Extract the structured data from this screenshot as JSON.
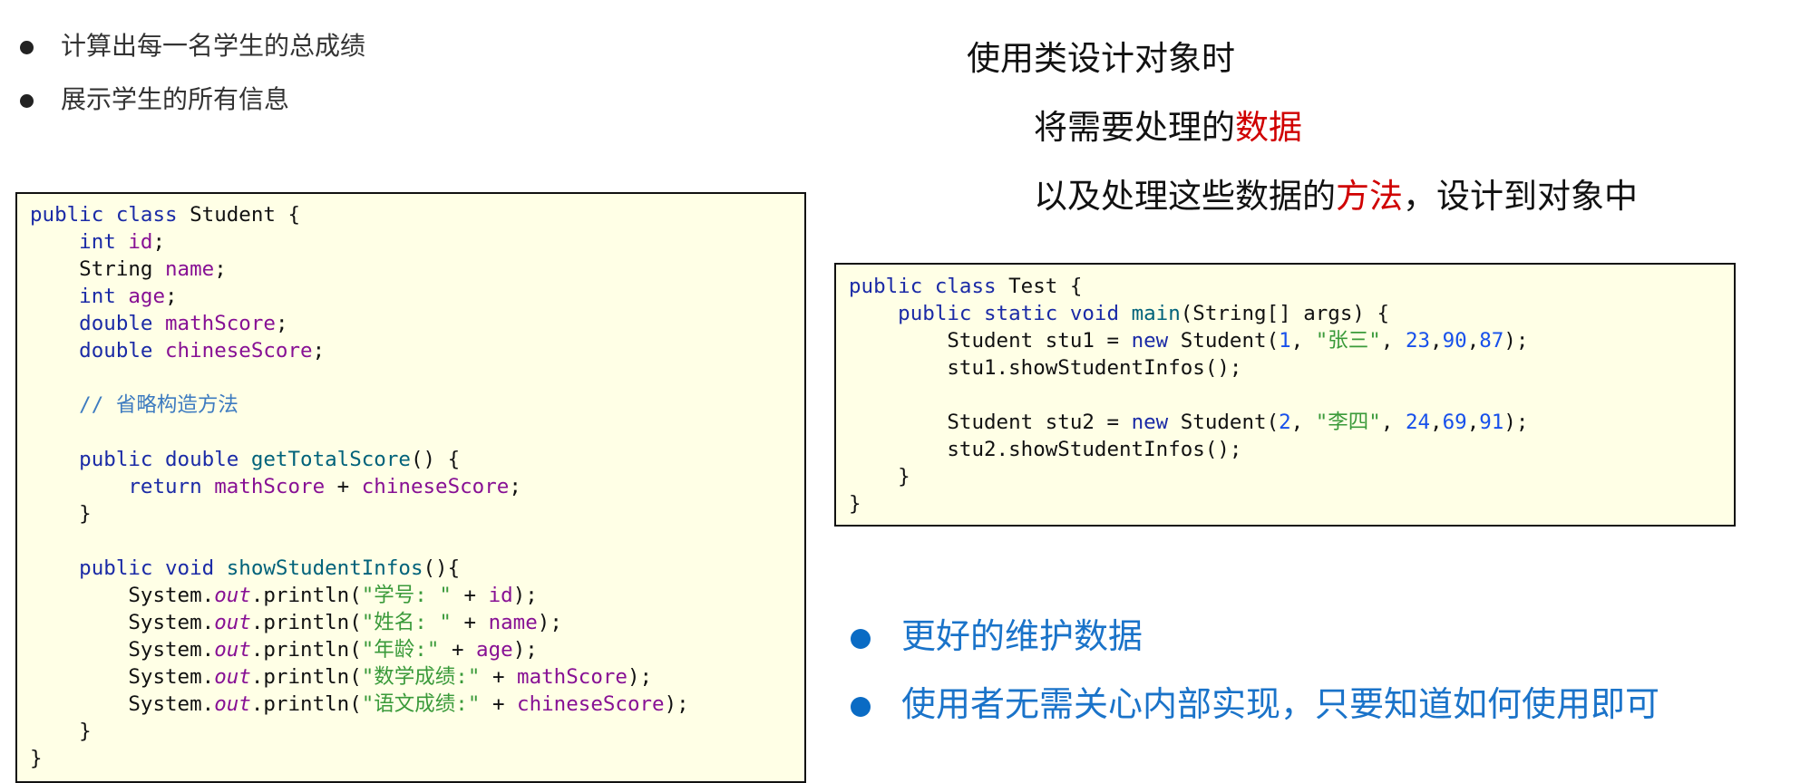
{
  "top_bullets": [
    "计算出每一名学生的总成绩",
    "展示学生的所有信息"
  ],
  "heading": {
    "line1": "使用类设计对象时",
    "line2_prefix": "将需要处理的",
    "line2_highlight": "数据",
    "line3_prefix": "以及处理这些数据的",
    "line3_highlight": "方法",
    "line3_suffix": "，设计到对象中",
    "highlight_color": "#d00000"
  },
  "student_code": [
    [
      {
        "t": "public class ",
        "c": "kw"
      },
      {
        "t": "Student {",
        "c": ""
      }
    ],
    [
      {
        "t": "    int ",
        "c": "kw"
      },
      {
        "t": "id",
        "c": "fld"
      },
      {
        "t": ";",
        "c": ""
      }
    ],
    [
      {
        "t": "    String ",
        "c": ""
      },
      {
        "t": "name",
        "c": "fld"
      },
      {
        "t": ";",
        "c": ""
      }
    ],
    [
      {
        "t": "    int ",
        "c": "kw"
      },
      {
        "t": "age",
        "c": "fld"
      },
      {
        "t": ";",
        "c": ""
      }
    ],
    [
      {
        "t": "    double ",
        "c": "kw"
      },
      {
        "t": "mathScore",
        "c": "fld"
      },
      {
        "t": ";",
        "c": ""
      }
    ],
    [
      {
        "t": "    double ",
        "c": "kw"
      },
      {
        "t": "chineseScore",
        "c": "fld"
      },
      {
        "t": ";",
        "c": ""
      }
    ],
    [],
    [
      {
        "t": "    // 省略构造方法",
        "c": "cmt"
      }
    ],
    [],
    [
      {
        "t": "    public double ",
        "c": "kw"
      },
      {
        "t": "getTotalScore",
        "c": "mth"
      },
      {
        "t": "() {",
        "c": ""
      }
    ],
    [
      {
        "t": "        return ",
        "c": "kw"
      },
      {
        "t": "mathScore",
        "c": "fld"
      },
      {
        "t": " + ",
        "c": ""
      },
      {
        "t": "chineseScore",
        "c": "fld"
      },
      {
        "t": ";",
        "c": ""
      }
    ],
    [
      {
        "t": "    }",
        "c": ""
      }
    ],
    [],
    [
      {
        "t": "    public void ",
        "c": "kw"
      },
      {
        "t": "showStudentInfos",
        "c": "mth"
      },
      {
        "t": "(){",
        "c": ""
      }
    ],
    [
      {
        "t": "        System.",
        "c": ""
      },
      {
        "t": "out",
        "c": "it"
      },
      {
        "t": ".println(",
        "c": ""
      },
      {
        "t": "\"学号: \"",
        "c": "str"
      },
      {
        "t": " + ",
        "c": ""
      },
      {
        "t": "id",
        "c": "fld"
      },
      {
        "t": ");",
        "c": ""
      }
    ],
    [
      {
        "t": "        System.",
        "c": ""
      },
      {
        "t": "out",
        "c": "it"
      },
      {
        "t": ".println(",
        "c": ""
      },
      {
        "t": "\"姓名: \"",
        "c": "str"
      },
      {
        "t": " + ",
        "c": ""
      },
      {
        "t": "name",
        "c": "fld"
      },
      {
        "t": ");",
        "c": ""
      }
    ],
    [
      {
        "t": "        System.",
        "c": ""
      },
      {
        "t": "out",
        "c": "it"
      },
      {
        "t": ".println(",
        "c": ""
      },
      {
        "t": "\"年龄:\"",
        "c": "str"
      },
      {
        "t": " + ",
        "c": ""
      },
      {
        "t": "age",
        "c": "fld"
      },
      {
        "t": ");",
        "c": ""
      }
    ],
    [
      {
        "t": "        System.",
        "c": ""
      },
      {
        "t": "out",
        "c": "it"
      },
      {
        "t": ".println(",
        "c": ""
      },
      {
        "t": "\"数学成绩:\"",
        "c": "str"
      },
      {
        "t": " + ",
        "c": ""
      },
      {
        "t": "mathScore",
        "c": "fld"
      },
      {
        "t": ");",
        "c": ""
      }
    ],
    [
      {
        "t": "        System.",
        "c": ""
      },
      {
        "t": "out",
        "c": "it"
      },
      {
        "t": ".println(",
        "c": ""
      },
      {
        "t": "\"语文成绩:\"",
        "c": "str"
      },
      {
        "t": " + ",
        "c": ""
      },
      {
        "t": "chineseScore",
        "c": "fld"
      },
      {
        "t": ");",
        "c": ""
      }
    ],
    [
      {
        "t": "    }",
        "c": ""
      }
    ],
    [
      {
        "t": "}",
        "c": ""
      }
    ]
  ],
  "test_code": [
    [
      {
        "t": "public class ",
        "c": "kw"
      },
      {
        "t": "Test {",
        "c": ""
      }
    ],
    [
      {
        "t": "    public static void ",
        "c": "kw"
      },
      {
        "t": "main",
        "c": "mth"
      },
      {
        "t": "(String[] args) {",
        "c": ""
      }
    ],
    [
      {
        "t": "        Student stu1 = ",
        "c": ""
      },
      {
        "t": "new ",
        "c": "kw"
      },
      {
        "t": "Student(",
        "c": ""
      },
      {
        "t": "1",
        "c": "num"
      },
      {
        "t": ", ",
        "c": ""
      },
      {
        "t": "\"张三\"",
        "c": "str"
      },
      {
        "t": ", ",
        "c": ""
      },
      {
        "t": "23",
        "c": "num"
      },
      {
        "t": ",",
        "c": ""
      },
      {
        "t": "90",
        "c": "num"
      },
      {
        "t": ",",
        "c": ""
      },
      {
        "t": "87",
        "c": "num"
      },
      {
        "t": ");",
        "c": ""
      }
    ],
    [
      {
        "t": "        stu1.showStudentInfos();",
        "c": ""
      }
    ],
    [],
    [
      {
        "t": "        Student stu2 = ",
        "c": ""
      },
      {
        "t": "new ",
        "c": "kw"
      },
      {
        "t": "Student(",
        "c": ""
      },
      {
        "t": "2",
        "c": "num"
      },
      {
        "t": ", ",
        "c": ""
      },
      {
        "t": "\"李四\"",
        "c": "str"
      },
      {
        "t": ", ",
        "c": ""
      },
      {
        "t": "24",
        "c": "num"
      },
      {
        "t": ",",
        "c": ""
      },
      {
        "t": "69",
        "c": "num"
      },
      {
        "t": ",",
        "c": ""
      },
      {
        "t": "91",
        "c": "num"
      },
      {
        "t": ");",
        "c": ""
      }
    ],
    [
      {
        "t": "        stu2.showStudentInfos();",
        "c": ""
      }
    ],
    [
      {
        "t": "    }",
        "c": ""
      }
    ],
    [
      {
        "t": "}",
        "c": ""
      }
    ]
  ],
  "benefits": [
    "更好的维护数据",
    "使用者无需关心内部实现，只要知道如何使用即可"
  ],
  "colors": {
    "benefit_text": "#1a73c9",
    "code_background": "#ffffe6"
  }
}
